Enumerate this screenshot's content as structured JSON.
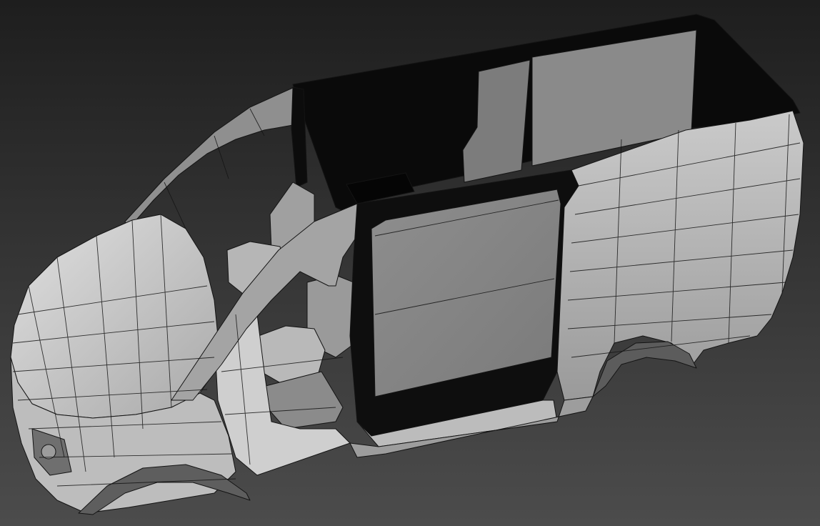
{
  "scene": {
    "subject": "wireframe-van-model",
    "colors": {
      "background_top": "#1e1e1e",
      "background_bottom": "#4c4c4c",
      "surface_light": "#cfcfcf",
      "surface_mid": "#a8a8a8",
      "surface_dark": "#7a7a7a",
      "interior_shadow": "#050505",
      "wire": "#141414"
    }
  }
}
